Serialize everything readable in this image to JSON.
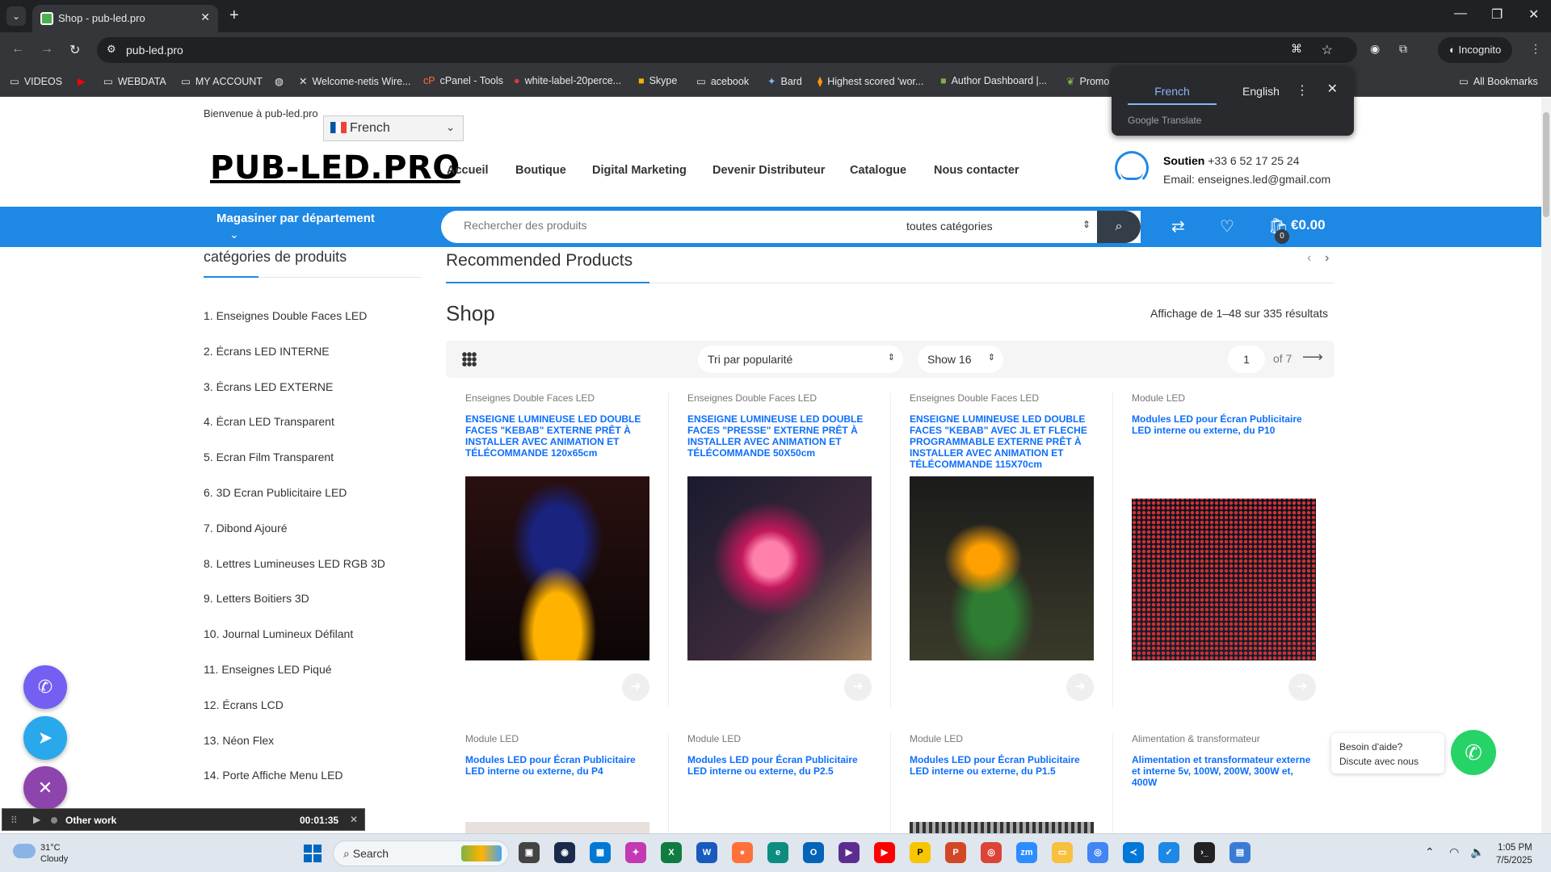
{
  "browser": {
    "tab_title": "Shop - pub-led.pro",
    "url": "pub-led.pro",
    "incognito_label": "Incognito",
    "bookmarks": [
      "VIDEOS",
      "WEBDATA",
      "MY ACCOUNT",
      "Welcome-netis Wire...",
      "cPanel - Tools",
      "white-label-20perce...",
      "Skype",
      "acebook",
      "Bard",
      "Highest scored 'wor...",
      "Author Dashboard |...",
      "Promo"
    ],
    "all_bookmarks": "All Bookmarks"
  },
  "translate": {
    "tab_source": "French",
    "tab_target": "English",
    "brand": "Google Translate"
  },
  "topbar": {
    "welcome": "Bienvenue à pub-led.pro",
    "language": "French"
  },
  "header": {
    "logo": "PUB-LED.PRO",
    "nav": [
      "Accueil",
      "Boutique",
      "Digital Marketing",
      "Devenir Distributeur",
      "Catalogue",
      "Nous contacter"
    ],
    "support_label": "Soutien",
    "support_phone": "+33 6 52 17 25 24",
    "support_email": "Email: enseignes.led@gmail.com"
  },
  "searchbar": {
    "department_label": "Magasiner par département",
    "search_placeholder": "Rechercher des produits",
    "category": "toutes catégories",
    "cart_count": "0",
    "cart_total": "€0.00"
  },
  "sidebar": {
    "title": "catégories de produits",
    "items": [
      "1. Enseignes Double Faces LED",
      "2. Écrans LED INTERNE",
      "3. Écrans LED EXTERNE",
      "4. Écran LED Transparent",
      "5. Ecran Film Transparent",
      "6. 3D Ecran Publicitaire LED",
      "7. Dibond Ajouré",
      "8. Lettres Lumineuses LED RGB 3D",
      "9. Letters Boitiers 3D",
      "10. Journal Lumineux Défilant",
      "11. Enseignes LED Piqué",
      "12. Écrans LCD",
      "13. Néon Flex",
      "14. Porte Affiche Menu LED"
    ]
  },
  "main": {
    "recommended_title": "Recommended Products",
    "shop_title": "Shop",
    "results": "Affichage de 1–48 sur 335 résultats",
    "sort": "Tri par popularité",
    "show": "Show 16",
    "page": "1",
    "of_pages": "of 7"
  },
  "products": [
    {
      "category": "Enseignes Double Faces LED",
      "name": "ENSEIGNE LUMINEUSE LED DOUBLE FACES \"KEBAB\" EXTERNE PRÊT À INSTALLER AVEC ANIMATION ET TÉLÉCOMMANDE 120x65cm"
    },
    {
      "category": "Enseignes Double Faces LED",
      "name": "ENSEIGNE LUMINEUSE LED DOUBLE FACES \"PRESSE\" EXTERNE PRÊT À INSTALLER AVEC ANIMATION ET TÉLÉCOMMANDE 50X50cm"
    },
    {
      "category": "Enseignes Double Faces LED",
      "name": "ENSEIGNE LUMINEUSE LED DOUBLE FACES \"KEBAB\" AVEC JL ET FLECHE PROGRAMMABLE EXTERNE PRÊT À INSTALLER AVEC ANIMATION ET TÉLÉCOMMANDE 115X70cm"
    },
    {
      "category": "Module LED",
      "name": "Modules LED pour Écran Publicitaire LED interne ou externe, du P10"
    },
    {
      "category": "Module LED",
      "name": "Modules LED pour Écran Publicitaire LED interne ou externe, du P4"
    },
    {
      "category": "Module LED",
      "name": "Modules LED pour Écran Publicitaire LED interne ou externe, du P2.5"
    },
    {
      "category": "Module LED",
      "name": "Modules LED pour Écran Publicitaire LED interne ou externe, du P1.5"
    },
    {
      "category": "Alimentation & transformateur",
      "name": "Alimentation et transformateur externe et interne 5v, 100W, 200W, 300W et, 400W"
    }
  ],
  "widgets": {
    "timer_label": "Other work",
    "timer_time": "00:01:35",
    "help_line1": "Besoin d'aide?",
    "help_line2": "Discute avec nous"
  },
  "taskbar": {
    "temp": "31°C",
    "weather": "Cloudy",
    "search": "Search",
    "time": "1:05 PM",
    "date": "7/5/2025"
  }
}
